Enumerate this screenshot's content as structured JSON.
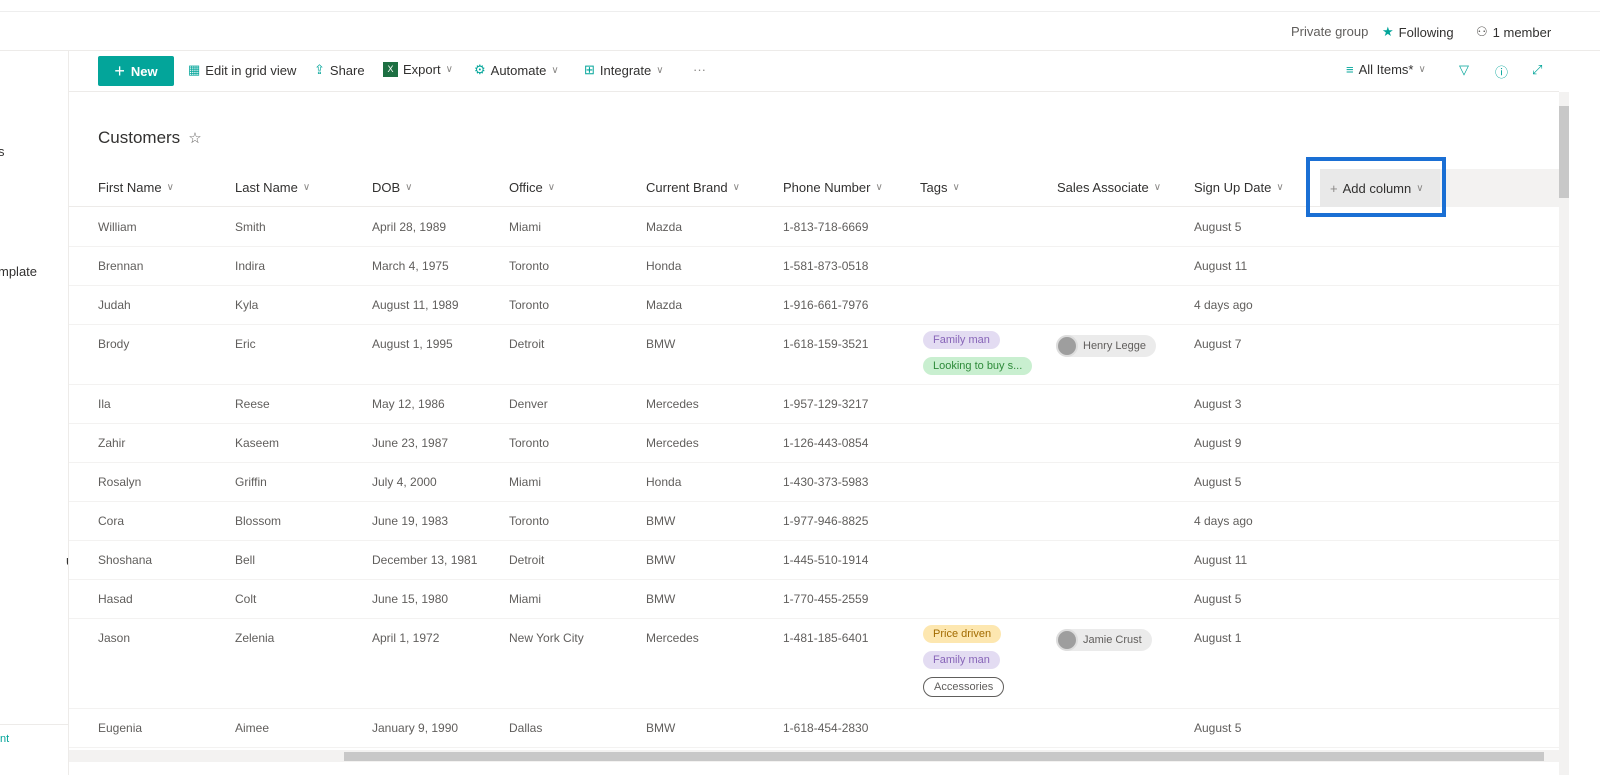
{
  "group": {
    "privacy": "Private group",
    "following": "Following",
    "members": "1 member"
  },
  "sidebar": {
    "fragments": [
      "s",
      "mplate",
      "uk",
      "nt"
    ]
  },
  "toolbar": {
    "new": "New",
    "edit_grid": "Edit in grid view",
    "share": "Share",
    "export": "Export",
    "automate": "Automate",
    "integrate": "Integrate",
    "more": "···",
    "view": "All Items*"
  },
  "list": {
    "title": "Customers"
  },
  "columns": [
    "First Name",
    "Last Name",
    "DOB",
    "Office",
    "Current Brand",
    "Phone Number",
    "Tags",
    "Sales Associate",
    "Sign Up Date"
  ],
  "add_column": "Add column",
  "colors": {
    "accent": "#03a59a",
    "highlight": "#1a6fd4"
  },
  "rows": [
    {
      "cells": [
        "William",
        "Smith",
        "April 28, 1989",
        "Miami",
        "Mazda",
        "1-813-718-6669"
      ],
      "tags": [],
      "associate": "",
      "signup": "August 5"
    },
    {
      "cells": [
        "Brennan",
        "Indira",
        "March 4, 1975",
        "Toronto",
        "Honda",
        "1-581-873-0518"
      ],
      "tags": [],
      "associate": "",
      "signup": "August 11"
    },
    {
      "cells": [
        "Judah",
        "Kyla",
        "August 11, 1989",
        "Toronto",
        "Mazda",
        "1-916-661-7976"
      ],
      "tags": [],
      "associate": "",
      "signup": "4 days ago"
    },
    {
      "cells": [
        "Brody",
        "Eric",
        "August 1, 1995",
        "Detroit",
        "BMW",
        "1-618-159-3521"
      ],
      "tags": [
        {
          "label": "Family man",
          "bg": "#e3dcf2",
          "fg": "#8764b8"
        },
        {
          "label": "Looking to buy s...",
          "bg": "#c9efd0",
          "fg": "#2e8b3a"
        }
      ],
      "associate": "Henry Legge",
      "signup": "August 7"
    },
    {
      "cells": [
        "Ila",
        "Reese",
        "May 12, 1986",
        "Denver",
        "Mercedes",
        "1-957-129-3217"
      ],
      "tags": [],
      "associate": "",
      "signup": "August 3"
    },
    {
      "cells": [
        "Zahir",
        "Kaseem",
        "June 23, 1987",
        "Toronto",
        "Mercedes",
        "1-126-443-0854"
      ],
      "tags": [],
      "associate": "",
      "signup": "August 9"
    },
    {
      "cells": [
        "Rosalyn",
        "Griffin",
        "July 4, 2000",
        "Miami",
        "Honda",
        "1-430-373-5983"
      ],
      "tags": [],
      "associate": "",
      "signup": "August 5"
    },
    {
      "cells": [
        "Cora",
        "Blossom",
        "June 19, 1983",
        "Toronto",
        "BMW",
        "1-977-946-8825"
      ],
      "tags": [],
      "associate": "",
      "signup": "4 days ago"
    },
    {
      "cells": [
        "Shoshana",
        "Bell",
        "December 13, 1981",
        "Detroit",
        "BMW",
        "1-445-510-1914"
      ],
      "tags": [],
      "associate": "",
      "signup": "August 11"
    },
    {
      "cells": [
        "Hasad",
        "Colt",
        "June 15, 1980",
        "Miami",
        "BMW",
        "1-770-455-2559"
      ],
      "tags": [],
      "associate": "",
      "signup": "August 5"
    },
    {
      "cells": [
        "Jason",
        "Zelenia",
        "April 1, 1972",
        "New York City",
        "Mercedes",
        "1-481-185-6401"
      ],
      "tags": [
        {
          "label": "Price driven",
          "bg": "#fde7b0",
          "fg": "#a26b00"
        },
        {
          "label": "Family man",
          "bg": "#e3dcf2",
          "fg": "#8764b8"
        },
        {
          "label": "Accessories",
          "bg": "#ffffff",
          "fg": "#605e5c",
          "border": "#605e5c"
        }
      ],
      "associate": "Jamie Crust",
      "signup": "August 1"
    },
    {
      "cells": [
        "Eugenia",
        "Aimee",
        "January 9, 1990",
        "Dallas",
        "BMW",
        "1-618-454-2830"
      ],
      "tags": [],
      "associate": "",
      "signup": "August 5"
    }
  ]
}
